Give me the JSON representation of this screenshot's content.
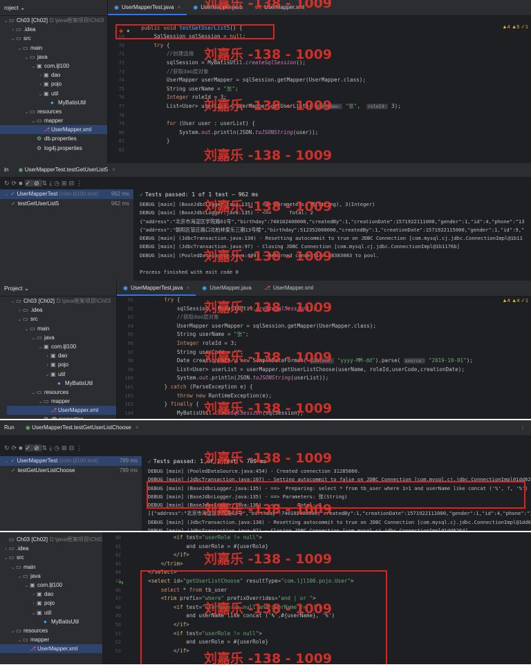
{
  "watermark": "刘嘉乐 -138 - 1009",
  "panel1": {
    "project_label": "roject",
    "tree": [
      {
        "arrow": "v",
        "icon": "folder",
        "label": "Ch03 [Ch02]",
        "path": "D:\\java框架项目\\Ch03",
        "indent": 0
      },
      {
        "arrow": ">",
        "icon": "folder",
        "label": ".idea",
        "path": "",
        "indent": 1
      },
      {
        "arrow": "v",
        "icon": "folder",
        "label": "src",
        "path": "",
        "indent": 1
      },
      {
        "arrow": "v",
        "icon": "folder",
        "label": "main",
        "path": "",
        "indent": 2
      },
      {
        "arrow": "v",
        "icon": "folder",
        "label": "java",
        "path": "",
        "indent": 3
      },
      {
        "arrow": "v",
        "icon": "pkg",
        "label": "com.ljl100",
        "path": "",
        "indent": 4
      },
      {
        "arrow": ">",
        "icon": "pkg",
        "label": "dao",
        "path": "",
        "indent": 5
      },
      {
        "arrow": ">",
        "icon": "pkg",
        "label": "pojo",
        "path": "",
        "indent": 5
      },
      {
        "arrow": "v",
        "icon": "pkg",
        "label": "util",
        "path": "",
        "indent": 5
      },
      {
        "arrow": "",
        "icon": "cls",
        "label": "MyBatisUtil",
        "path": "",
        "indent": 6
      },
      {
        "arrow": "v",
        "icon": "folder",
        "label": "resources",
        "path": "",
        "indent": 3
      },
      {
        "arrow": "v",
        "icon": "folder",
        "label": "mapper",
        "path": "",
        "indent": 4
      },
      {
        "arrow": "",
        "icon": "xml",
        "label": "UserMapper.xml",
        "path": "",
        "indent": 5,
        "selected": true
      },
      {
        "arrow": "",
        "icon": "props",
        "label": "db.properties",
        "path": "",
        "indent": 4
      },
      {
        "arrow": "",
        "icon": "props",
        "label": "log4j.properties",
        "path": "",
        "indent": 4
      }
    ],
    "tabs": [
      {
        "label": "UserMapperTest.java",
        "icon": "java",
        "active": true,
        "closable": true
      },
      {
        "label": "UserMapper.java",
        "icon": "java",
        "active": false,
        "closable": false
      },
      {
        "label": "UserMapper.xml",
        "icon": "xml",
        "active": false,
        "closable": false
      }
    ],
    "inspections": "▲4 ▲5 ✓1",
    "line_numbers": [
      "",
      "",
      "69",
      "70",
      "71",
      "72",
      "73",
      "74",
      "75",
      "76",
      "77",
      "78",
      "79",
      "80",
      "81",
      "82"
    ],
    "code": [
      "",
      "    public void testGetUserList5() {",
      "        SqlSession sqlSession = null;",
      "        try {",
      "            //创建连接",
      "            sqlSession = MyBatisUtil.createSqlSession();",
      "            //获取dao层对象",
      "            UserMapper userMapper = sqlSession.getMapper(UserMapper.class);",
      "            String userName = \"张\";",
      "            Integer roleId = 3;",
      "            List<User> userList = userMapper.getUserList5( userName: \"张\",  roleId: 3);",
      "",
      "            for (User user : userList) {",
      "                System.out.println(JSON.toJSONString(user));",
      "            }",
      "",
      ""
    ]
  },
  "panel2": {
    "run_label": "in",
    "run_tab": "UserMapperTest.testGetUserList5",
    "tests": [
      {
        "label": "UserMapperTest",
        "meta": "(com.ljl100.test)",
        "time": "962 ms",
        "selected": true,
        "indent": 0
      },
      {
        "label": "testGetUserList5",
        "meta": "",
        "time": "962 ms",
        "selected": false,
        "indent": 1
      }
    ],
    "status": "Tests passed: 1 of 1 test – 962 ms",
    "console": [
      "DEBUG [main] (BaseJdbcLogger.java:135) - ==> Parameters: 张(String), 3(Integer)",
      "DEBUG [main] (BaseJdbcLogger.java:135) - <==      Total: 2",
      "{\"address\":\"北京市海淀区学院路61号\",\"birthday\":740102400000,\"createdBy\":1,\"creationDate\":1571922111000,\"gender\":1,\"id\":4,\"phone\":\"13",
      "{\"address\":\"朝阳区管庄路口北柏林爱乐三期13号楼\",\"birthday\":512352000000,\"createdBy\":1,\"creationDate\":1571922115000,\"gender\":1,\"id\":9,\"",
      "DEBUG [main] (JdbcTransaction.java:130) - Resetting autocommit to true on JDBC Connection [com.mysql.cj.jdbc.ConnectionImpl@1b11",
      "DEBUG [main] (JdbcTransaction.java:97) - Closing JDBC Connection [com.mysql.cj.jdbc.ConnectionImpl@1b1176b]",
      "DEBUG [main] (PooledDataSource.java:409) - Returned connection 28383083 to pool.",
      "",
      "Process finished with exit code 0"
    ]
  },
  "panel3": {
    "project_label": "Project",
    "tree": [
      {
        "arrow": "v",
        "icon": "folder",
        "label": "Ch03 [Ch02]",
        "path": "D:\\java框架项目\\Ch03",
        "indent": 0
      },
      {
        "arrow": ">",
        "icon": "folder",
        "label": ".idea",
        "path": "",
        "indent": 1
      },
      {
        "arrow": "v",
        "icon": "folder",
        "label": "src",
        "path": "",
        "indent": 1
      },
      {
        "arrow": "v",
        "icon": "folder",
        "label": "main",
        "path": "",
        "indent": 2
      },
      {
        "arrow": "v",
        "icon": "folder",
        "label": "java",
        "path": "",
        "indent": 3
      },
      {
        "arrow": "v",
        "icon": "pkg",
        "label": "com.ljl100",
        "path": "",
        "indent": 4
      },
      {
        "arrow": ">",
        "icon": "pkg",
        "label": "dao",
        "path": "",
        "indent": 5
      },
      {
        "arrow": ">",
        "icon": "pkg",
        "label": "pojo",
        "path": "",
        "indent": 5
      },
      {
        "arrow": "v",
        "icon": "pkg",
        "label": "util",
        "path": "",
        "indent": 5
      },
      {
        "arrow": "",
        "icon": "cls",
        "label": "MyBatisUtil",
        "path": "",
        "indent": 6
      },
      {
        "arrow": "v",
        "icon": "folder",
        "label": "resources",
        "path": "",
        "indent": 3
      },
      {
        "arrow": "v",
        "icon": "folder",
        "label": "mapper",
        "path": "",
        "indent": 4
      },
      {
        "arrow": "",
        "icon": "xml",
        "label": "UserMapper.xml",
        "path": "",
        "indent": 5,
        "selected": true
      },
      {
        "arrow": "",
        "icon": "props",
        "label": "db.properties",
        "path": "",
        "indent": 4
      },
      {
        "arrow": "",
        "icon": "props",
        "label": "log4j.properties",
        "path": "",
        "indent": 4
      }
    ],
    "tabs": [
      {
        "label": "UserMapperTest.java",
        "icon": "java",
        "active": true,
        "closable": true
      },
      {
        "label": "UserMapper.java",
        "icon": "java",
        "active": false,
        "closable": false
      },
      {
        "label": "UserMapper.xml",
        "icon": "xml",
        "active": false,
        "closable": false
      }
    ],
    "inspections": "▲4 ▲4 ✓1",
    "line_numbers": [
      "91",
      "92",
      "93",
      "94",
      "95",
      "96",
      "97",
      "98",
      "99",
      "100",
      "101",
      "102",
      "103",
      "104",
      "105",
      ""
    ],
    "code": [
      "        try {",
      "            sqlSession = MyBatisUtil.createSqlSession();",
      "            //获取dao层对象",
      "            UserMapper userMapper = sqlSession.getMapper(UserMapper.class);",
      "            String userName = \"张\";",
      "            Integer roleId = 3;",
      "            String userCode = \"\";",
      "            Date creationDate = new SimpleDateFormat( pattern: \"yyyy-MM-dd\").parse( source: \"2019-10-01\");",
      "            List<User> userList = userMapper.getUserListChoose(userName, roleId,userCode,creationDate);",
      "            System.out.println(JSON.toJSONString(userList));",
      "        } catch (ParseException e) {",
      "            throw new RuntimeException(e);",
      "        } finally {",
      "            MyBatisUtil.closeSqlSession(sqlSession);",
      "        }",
      "    }"
    ]
  },
  "panel4": {
    "run_label": "Run",
    "run_tab": "UserMapperTest.testGetUserListChoose",
    "tests": [
      {
        "label": "UserMapperTest",
        "meta": "(com.ljl100.test)",
        "time": "789 ms",
        "selected": true,
        "indent": 0
      },
      {
        "label": "testGetUserListChoose",
        "meta": "",
        "time": "789 ms",
        "selected": false,
        "indent": 1
      }
    ],
    "status": "Tests passed: 1 of 1 test – 789 ms",
    "console": [
      "DEBUG [main] (PooledDataSource.java:454) - Created connection 31285860.",
      "DEBUG [main] (JdbcTransaction.java:107) - Setting autocommit to false on JDBC Connection [com.mysql.cj.jdbc.ConnectionImpl@1dd626",
      "DEBUG [main] (BaseJdbcLogger.java:135) - ==>  Preparing: select * from tb_user where 1=1 and userName like concat ('%', ?, '%')",
      "DEBUG [main] (BaseJdbcLogger.java:135) - ==> Parameters: 张(String)",
      "DEBUG [main] (BaseJdbcLogger.java:135) - <==      Total: 3",
      "[{\"address\":\"北京市海淀区学院路61号\",\"birthday\":740102400000,\"createdBy\":1,\"creationDate\":1571922111000,\"gender\":1,\"id\":4,\"phone\":\"13",
      "DEBUG [main] (JdbcTransaction.java:130) - Resetting autocommit to true on JDBC Connection [com.mysql.cj.jdbc.ConnectionImpl@1dd626",
      "DEBUG [main] (JdbcTransaction.java:97) - Closing JDBC Connection [com.mysql.cj.jdbc.ConnectionImpl@1dd6264]"
    ]
  },
  "panel5": {
    "tree": [
      {
        "arrow": "",
        "icon": "folder",
        "label": "Ch03 [Ch02]",
        "path": "D:\\java框架项目\\Ch03",
        "indent": 0
      },
      {
        "arrow": ">",
        "icon": "folder",
        "label": ".idea",
        "path": "",
        "indent": 0
      },
      {
        "arrow": "v",
        "icon": "folder",
        "label": "src",
        "path": "",
        "indent": 0
      },
      {
        "arrow": "v",
        "icon": "folder",
        "label": "main",
        "path": "",
        "indent": 1
      },
      {
        "arrow": "v",
        "icon": "folder",
        "label": "java",
        "path": "",
        "indent": 2
      },
      {
        "arrow": "v",
        "icon": "pkg",
        "label": "com.ljl100",
        "path": "",
        "indent": 3
      },
      {
        "arrow": ">",
        "icon": "pkg",
        "label": "dao",
        "path": "",
        "indent": 4
      },
      {
        "arrow": ">",
        "icon": "pkg",
        "label": "pojo",
        "path": "",
        "indent": 4
      },
      {
        "arrow": "v",
        "icon": "pkg",
        "label": "util",
        "path": "",
        "indent": 4
      },
      {
        "arrow": "",
        "icon": "cls",
        "label": "MyBatisUtil",
        "path": "",
        "indent": 5
      },
      {
        "arrow": "v",
        "icon": "folder",
        "label": "resources",
        "path": "",
        "indent": 1
      },
      {
        "arrow": "v",
        "icon": "folder",
        "label": "mapper",
        "path": "",
        "indent": 2
      },
      {
        "arrow": "",
        "icon": "xml",
        "label": "UserMapper.xml",
        "path": "",
        "indent": 3,
        "selected": true
      }
    ],
    "line_numbers": [
      "40",
      "41",
      "42",
      "43",
      "44",
      "45",
      "46",
      "47",
      "48",
      "49",
      "50",
      "51",
      "52",
      "53"
    ],
    "code": [
      "            <if test=\"userRole != null\">",
      "                and userRole = #{userRole}",
      "            </if>",
      "        </trim>",
      "    </select>",
      "    <select id=\"getUserListChoose\" resultType=\"com.ljl100.pojo.User\">",
      "        select * from tb_user",
      "        <trim prefix=\"where\" prefixOverrides=\"and | or \">",
      "            <if test=\"userName != null and userName != ''\">",
      "                and userName like concat ('%',#{userName}, '%')",
      "            </if>",
      "            <if test=\"userRole != null\">",
      "                and userRole = #{userRole}",
      "            </if>"
    ]
  }
}
